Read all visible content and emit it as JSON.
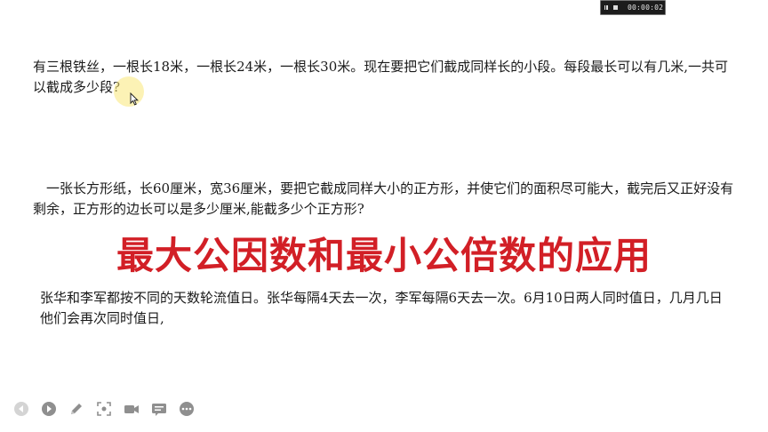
{
  "recorder": {
    "time": "00:00:02",
    "pause_icon": "pause-icon",
    "stop_icon": "stop-icon"
  },
  "problems": [
    {
      "text": "有三根铁丝，一根长18米，一根长24米，一根长30米。现在要把它们截成同样长的小段。每段最长可以有几米,一共可以截成多少段?"
    },
    {
      "text": "一张长方形纸，长60厘米，宽36厘米，要把它截成同样大小的正方形，并使它们的面积尽可能大，截完后又正好没有剩余，正方形的边长可以是多少厘米,能截多少个正方形?"
    },
    {
      "text": "张华和李军都按不同的天数轮流值日。张华每隔4天去一次，李军每隔6天去一次。6月10日两人同时值日，几月几日他们会再次同时值日,"
    }
  ],
  "headline": "最大公因数和最小公倍数的应用",
  "colors": {
    "headline": "#d21f26",
    "body_text": "#1a1a1a",
    "background": "#ffffff",
    "cursor_highlight": "#fae878",
    "toolbar_icon": "#9a9a9a"
  },
  "toolbar": [
    {
      "icon": "previous-icon"
    },
    {
      "icon": "next-icon"
    },
    {
      "icon": "pen-icon"
    },
    {
      "icon": "zoom-icon"
    },
    {
      "icon": "camera-icon"
    },
    {
      "icon": "subtitles-icon"
    },
    {
      "icon": "more-icon"
    }
  ]
}
